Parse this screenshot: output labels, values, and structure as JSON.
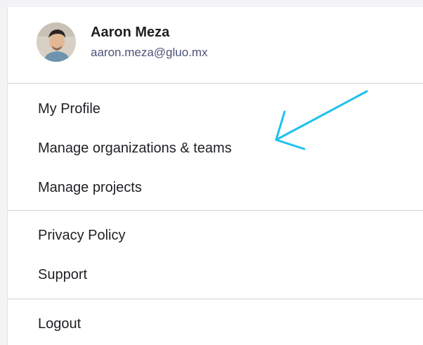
{
  "user": {
    "name": "Aaron Meza",
    "email": "aaron.meza@gluo.mx"
  },
  "menu": {
    "groups": [
      {
        "items": [
          {
            "label": "My Profile"
          },
          {
            "label": "Manage organizations & teams"
          },
          {
            "label": "Manage projects"
          }
        ]
      },
      {
        "items": [
          {
            "label": "Privacy Policy"
          },
          {
            "label": "Support"
          }
        ]
      },
      {
        "items": [
          {
            "label": "Logout"
          }
        ]
      }
    ]
  },
  "colors": {
    "annotation_arrow": "#1ec0f0",
    "divider": "#cfd0d6",
    "email_text": "#4a5278"
  },
  "icons": {
    "annotation": "arrow-icon"
  }
}
